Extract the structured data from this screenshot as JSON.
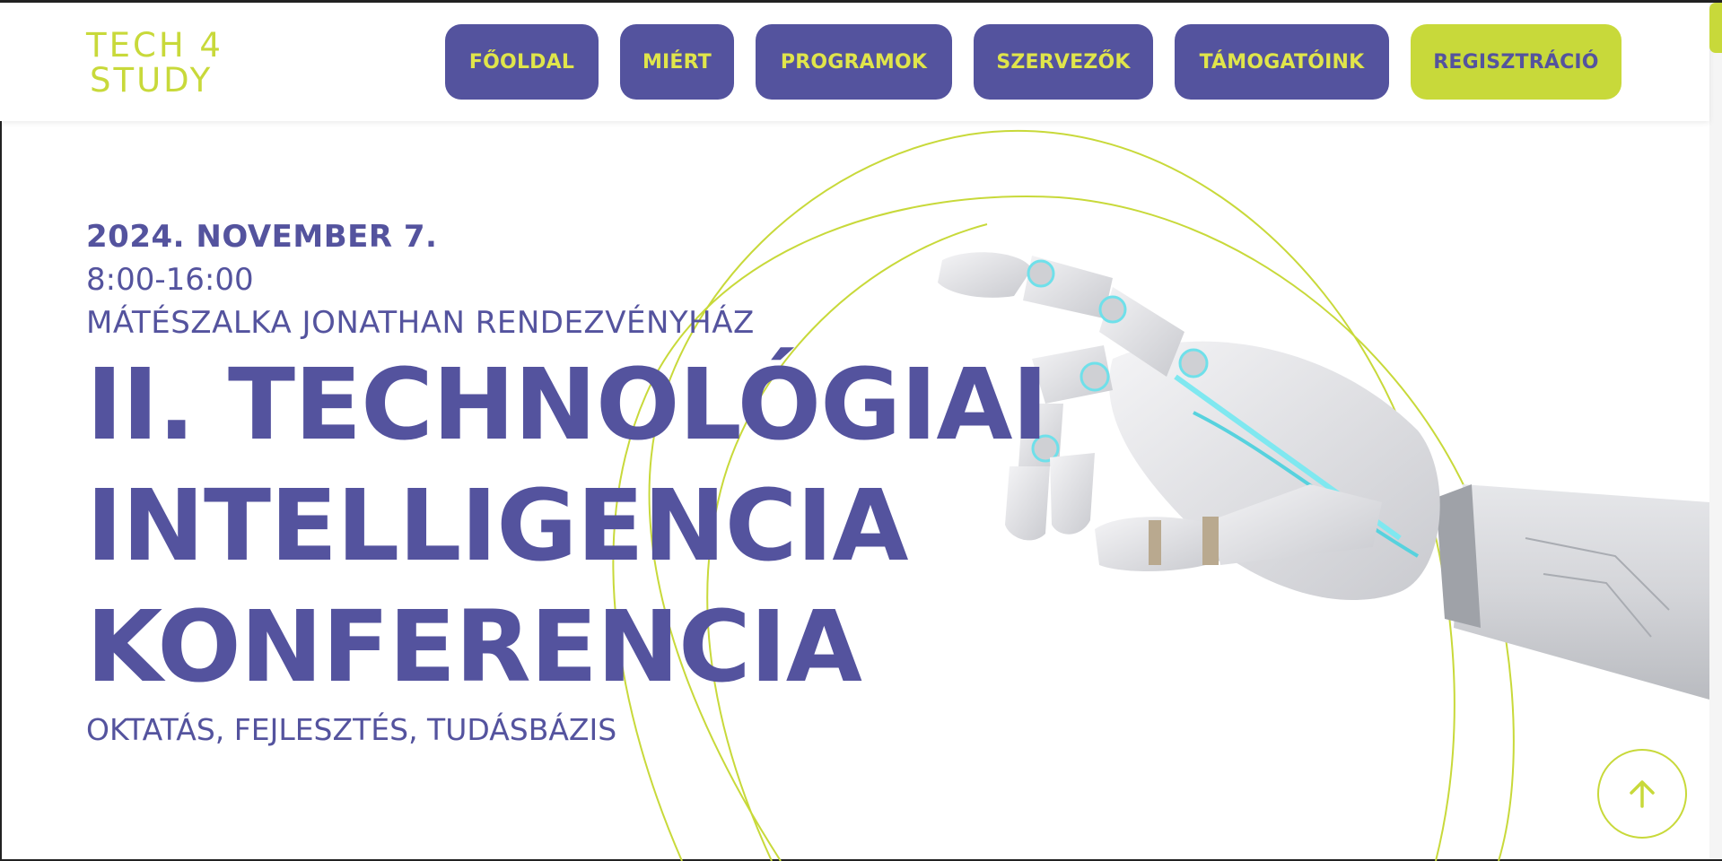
{
  "logo": {
    "line1": "TECH 4",
    "line2": "STUDY"
  },
  "nav": {
    "items": [
      {
        "label": "FŐOLDAL"
      },
      {
        "label": "MIÉRT"
      },
      {
        "label": "PROGRAMOK"
      },
      {
        "label": "SZERVEZŐK"
      },
      {
        "label": "TÁMOGATÓINK"
      }
    ],
    "register_label": "REGISZTRÁCIÓ"
  },
  "hero": {
    "date": "2024. NOVEMBER 7.",
    "time": "8:00-16:00",
    "venue": "MÁTÉSZALKA JONATHAN RENDEZVÉNYHÁZ",
    "title_lines": [
      "II. TECHNOLÓGIAI",
      "INTELLIGENCIA",
      "KONFERENCIA"
    ],
    "subtitle": "OKTATÁS, FEJLESZTÉS, TUDÁSBÁZIS"
  },
  "icons": {
    "scroll_top": "arrow-up-icon",
    "hero_image": "robot-hand-icon"
  },
  "colors": {
    "primary": "#54539e",
    "accent": "#c8d93a",
    "nav_text": "#e0e54a"
  }
}
